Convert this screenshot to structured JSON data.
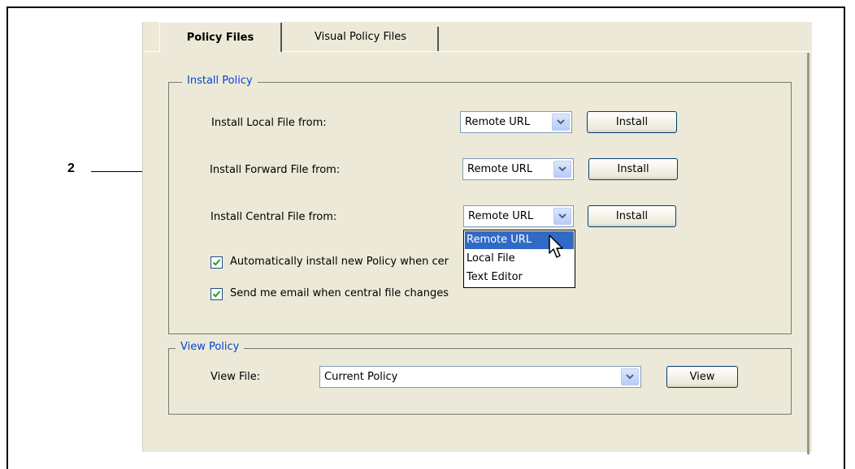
{
  "callout": {
    "number": "2"
  },
  "tabs": [
    {
      "label": "Policy Files",
      "active": true
    },
    {
      "label": "Visual Policy Files",
      "active": false
    }
  ],
  "install_policy": {
    "title": "Install Policy",
    "rows": [
      {
        "label": "Install Local File from:",
        "select": "Remote URL",
        "button": "Install"
      },
      {
        "label": "Install Forward File from:",
        "select": "Remote URL",
        "button": "Install"
      },
      {
        "label": "Install Central File from:",
        "select": "Remote URL",
        "button": "Install"
      }
    ],
    "dropdown_options": [
      "Remote URL",
      "Local File",
      "Text Editor"
    ],
    "highlighted_option": "Remote URL",
    "checkboxes": [
      {
        "label": "Automatically install new Policy when cer",
        "checked": true
      },
      {
        "label": "Send me email when central file changes",
        "checked": true
      }
    ]
  },
  "view_policy": {
    "title": "View Policy",
    "label": "View File:",
    "select": "Current Policy",
    "button": "View"
  },
  "colors": {
    "accent": "#316ac5",
    "group_title": "#0046d5",
    "dialog_bg": "#ece9d8"
  }
}
